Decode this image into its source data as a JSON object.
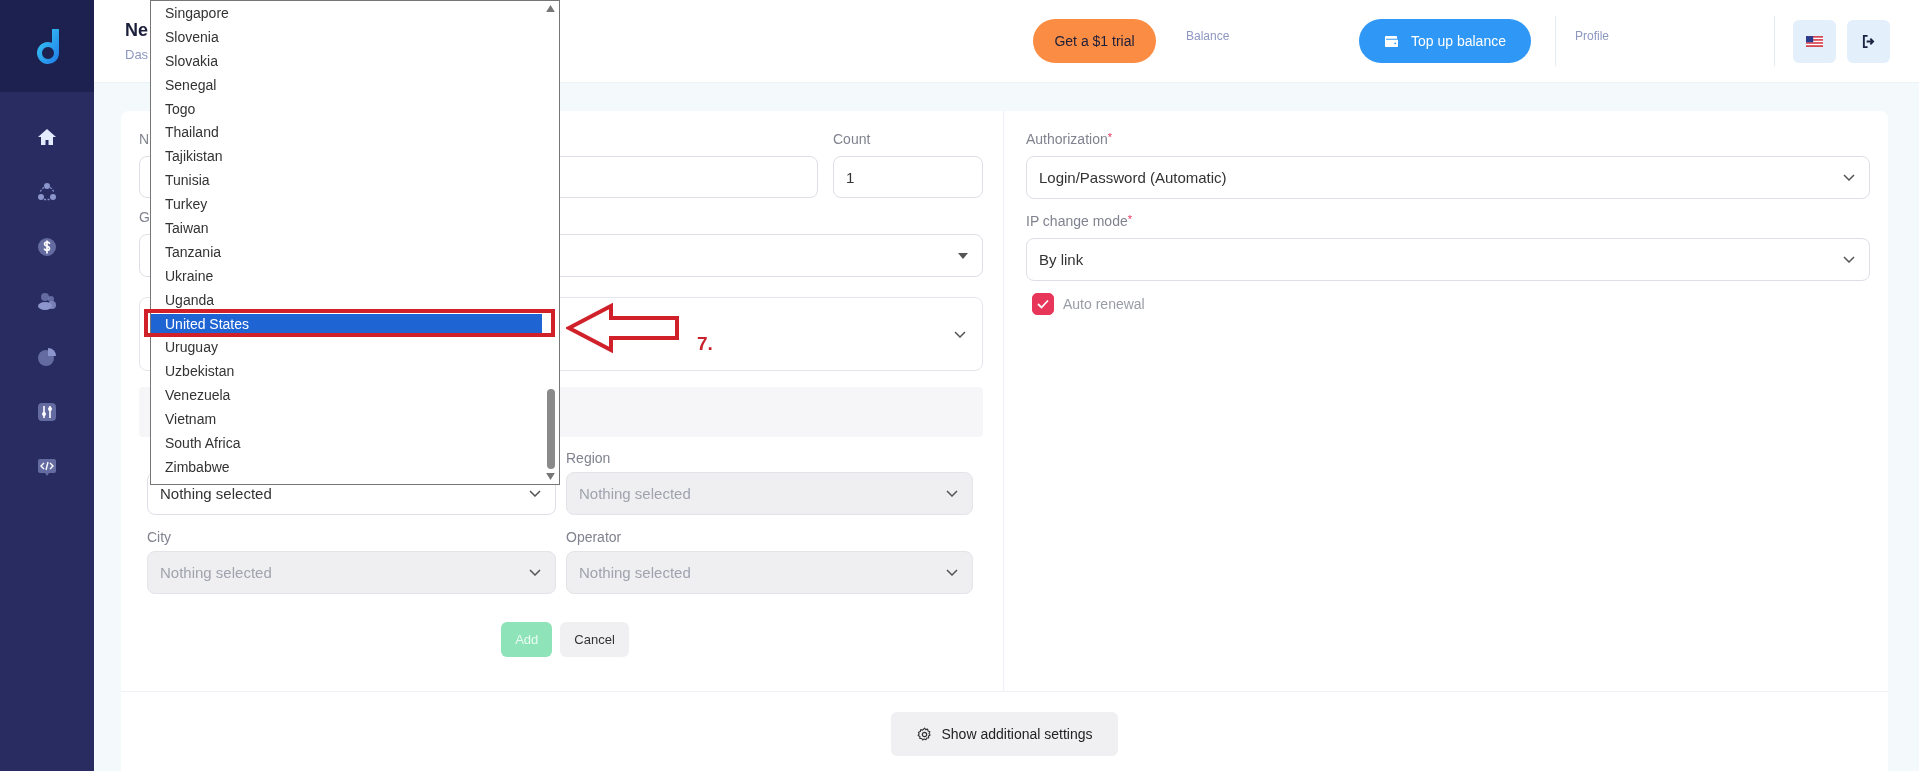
{
  "sidebar": {
    "items": [
      {
        "kind": "home",
        "selected": true
      },
      {
        "kind": "network",
        "selected": false
      },
      {
        "kind": "dollar",
        "selected": false
      },
      {
        "kind": "users",
        "selected": false
      },
      {
        "kind": "pie",
        "selected": false
      },
      {
        "kind": "sliders",
        "selected": false
      },
      {
        "kind": "code",
        "selected": false
      }
    ]
  },
  "header": {
    "title": "Ne",
    "breadcrumb": "Das",
    "trial_button": "Get a $1 trial",
    "balance_label": "Balance",
    "topup_button": "Top up balance",
    "profile_label": "Profile"
  },
  "form": {
    "name_label": "N",
    "count_label": "Count",
    "count_value": "1",
    "group_label": "G",
    "country_select": {
      "value": "Nothing selected",
      "disabled": false
    },
    "location_fields": [
      {
        "label": "Region",
        "value": "Nothing selected",
        "disabled": true
      },
      {
        "label": "City",
        "value": "Nothing selected",
        "disabled": true
      },
      {
        "label": "Operator",
        "value": "Nothing selected",
        "disabled": true
      }
    ],
    "buttons": [
      {
        "label": "Add",
        "kind": "primary",
        "disabled": true
      },
      {
        "label": "Cancel",
        "kind": "secondary",
        "disabled": false
      }
    ]
  },
  "settings": {
    "fields": [
      {
        "label": "Authorization",
        "required_mark": "*",
        "value": "Login/Password (Automatic)"
      },
      {
        "label": "IP change mode",
        "required_mark": "*",
        "value": "By link"
      }
    ],
    "auto_renewal": {
      "label": "Auto renewal",
      "checked": true
    }
  },
  "additional_settings_button": "Show additional settings",
  "dropdown": {
    "options": [
      {
        "label": "Singapore",
        "selected": false
      },
      {
        "label": "Slovenia",
        "selected": false
      },
      {
        "label": "Slovakia",
        "selected": false
      },
      {
        "label": "Senegal",
        "selected": false
      },
      {
        "label": "Togo",
        "selected": false
      },
      {
        "label": "Thailand",
        "selected": false
      },
      {
        "label": "Tajikistan",
        "selected": false
      },
      {
        "label": "Tunisia",
        "selected": false
      },
      {
        "label": "Turkey",
        "selected": false
      },
      {
        "label": "Taiwan",
        "selected": false
      },
      {
        "label": "Tanzania",
        "selected": false
      },
      {
        "label": "Ukraine",
        "selected": false
      },
      {
        "label": "Uganda",
        "selected": false
      },
      {
        "label": "United States",
        "selected": true
      },
      {
        "label": "Uruguay",
        "selected": false
      },
      {
        "label": "Uzbekistan",
        "selected": false
      },
      {
        "label": "Venezuela",
        "selected": false
      },
      {
        "label": "Vietnam",
        "selected": false
      },
      {
        "label": "South Africa",
        "selected": false
      },
      {
        "label": "Zimbabwe",
        "selected": false
      }
    ]
  },
  "annotation": {
    "step": "7."
  }
}
